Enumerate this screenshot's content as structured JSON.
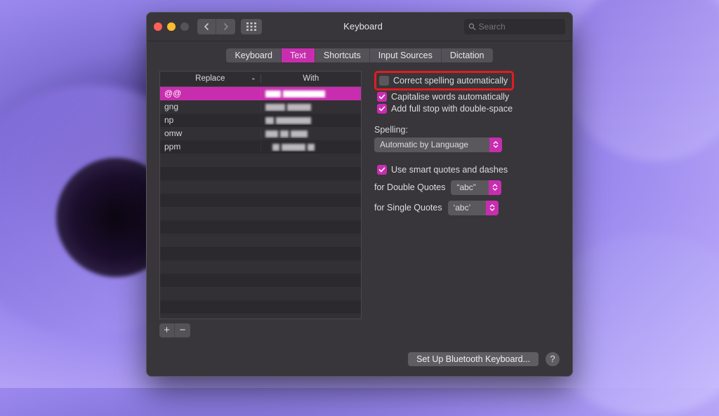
{
  "window": {
    "title": "Keyboard"
  },
  "search": {
    "placeholder": "Search"
  },
  "tabs": [
    "Keyboard",
    "Text",
    "Shortcuts",
    "Input Sources",
    "Dictation"
  ],
  "activeTab": 1,
  "table": {
    "columns": [
      "Replace",
      "With"
    ],
    "rows": [
      {
        "replace": "@@",
        "selected": true
      },
      {
        "replace": "gng"
      },
      {
        "replace": "np"
      },
      {
        "replace": "omw"
      },
      {
        "replace": "ppm"
      }
    ]
  },
  "options": {
    "correctSpelling": {
      "label": "Correct spelling automatically",
      "checked": false
    },
    "capitalise": {
      "label": "Capitalise words automatically",
      "checked": true
    },
    "fullStop": {
      "label": "Add full stop with double-space",
      "checked": true
    },
    "spellingLabel": "Spelling:",
    "spellingValue": "Automatic by Language",
    "smartQuotes": {
      "label": "Use smart quotes and dashes",
      "checked": true
    },
    "doubleQuotesLabel": "for Double Quotes",
    "doubleQuotesValue": "“abc”",
    "singleQuotesLabel": "for Single Quotes",
    "singleQuotesValue": "‘abc’"
  },
  "footer": {
    "bluetooth": "Set Up Bluetooth Keyboard...",
    "help": "?"
  },
  "icons": {
    "add": "+",
    "remove": "−"
  }
}
